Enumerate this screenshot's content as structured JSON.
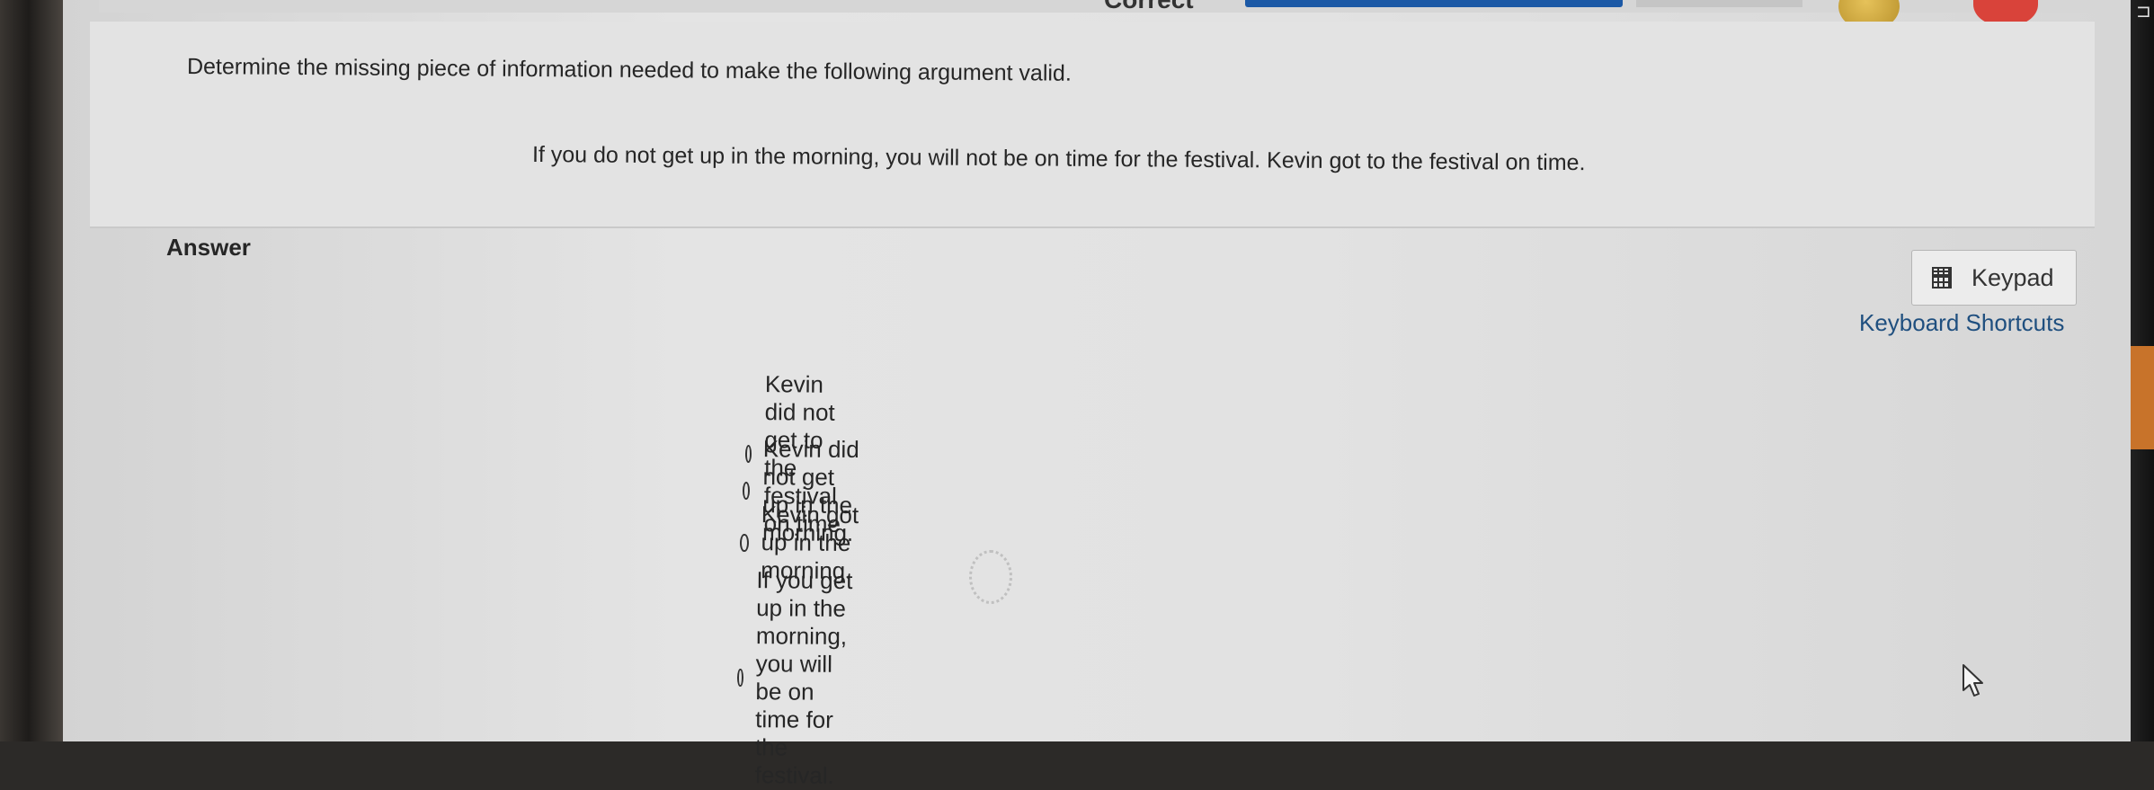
{
  "header": {
    "status": "Correct"
  },
  "question": {
    "prompt": "Determine the missing piece of information needed to make the following argument valid.",
    "statement": "If you do not get up in the morning, you will not be on time for the festival. Kevin got to the festival on time."
  },
  "answer": {
    "label": "Answer",
    "options": [
      {
        "label": "Kevin did not get to the festival on time."
      },
      {
        "label": "Kevin did not get up in the morning."
      },
      {
        "label": "Kevin got up in the morning."
      },
      {
        "label": "If you get up in the morning, you will be on time for the festival."
      }
    ]
  },
  "tools": {
    "keypad_label": "Keypad",
    "shortcuts_label": "Keyboard Shortcuts"
  },
  "colors": {
    "progress": "#1c59a6",
    "link": "#1f4f7f",
    "heart": "#d9433a",
    "coin": "#d2a83c"
  },
  "icons": [
    "coin-icon",
    "heart-icon",
    "calculator-icon",
    "radio-icon",
    "mouse-pointer-icon"
  ]
}
